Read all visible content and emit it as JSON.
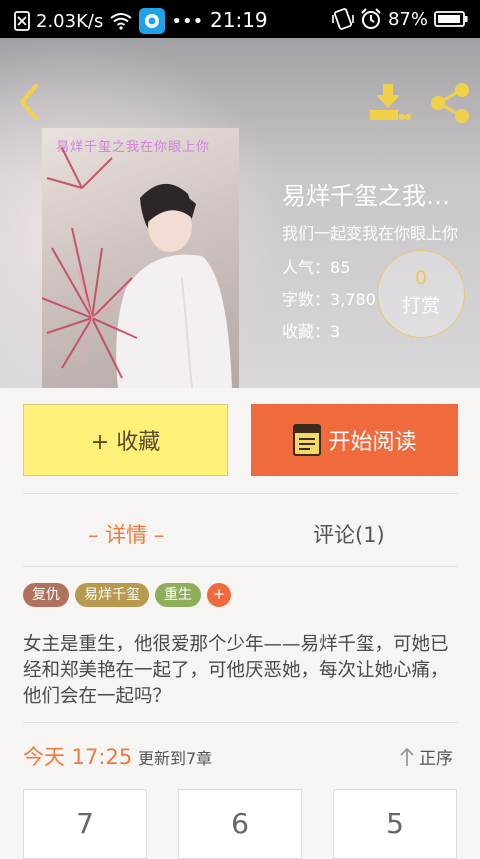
{
  "status_bar": {
    "speed": "2.03K/s",
    "time": "21:19",
    "battery": "87%"
  },
  "book": {
    "cover_title": "易烊千玺之我在你眼上你",
    "title": "易烊千玺之我在你眼上你",
    "subtitle": "我们一起变我在你眼上你",
    "stats": [
      {
        "label": "人气：",
        "value": "85"
      },
      {
        "label": "字数：",
        "value": "3,780"
      },
      {
        "label": "收藏：",
        "value": "3"
      }
    ],
    "reward": {
      "count": "0",
      "label": "打赏"
    }
  },
  "actions": {
    "favorite_label": "+ 收藏",
    "read_label": "开始阅读"
  },
  "tabs": {
    "detail": "– 详情 –",
    "comments": "评论(1)"
  },
  "tags": [
    {
      "label": "复仇",
      "color": "#b0725c"
    },
    {
      "label": "易烊千玺",
      "color": "#b79a4e"
    },
    {
      "label": "重生",
      "color": "#8fae5a"
    }
  ],
  "tag_add": "+",
  "description": "女主是重生，他很爱那个少年——易烊千玺，可她已经和郑美艳在一起了，可他厌恶她，每次让她心痛，他们会在一起吗？",
  "update": {
    "time": "今天 17:25",
    "text": "更新到7章",
    "sort_label": "正序"
  },
  "chapters": [
    "7",
    "6",
    "5"
  ],
  "colors": {
    "accent": "#ef6a3c",
    "favorite_bg": "#fff07a",
    "icon_yellow": "#f2d14a"
  }
}
